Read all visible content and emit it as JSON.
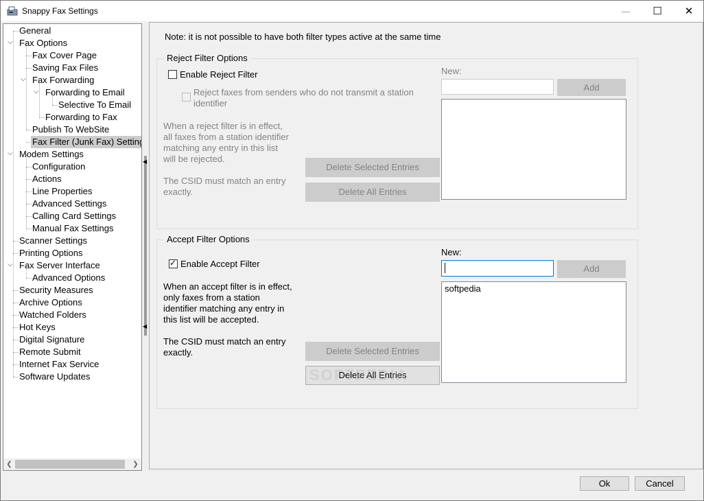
{
  "window": {
    "title": "Snappy Fax Settings",
    "minimize_glyph": "—",
    "maximize_glyph": "☐",
    "close_glyph": "✕"
  },
  "tree": {
    "items": [
      {
        "label": "General"
      },
      {
        "label": "Fax Options"
      },
      {
        "label": "Fax Cover Page"
      },
      {
        "label": "Saving Fax Files"
      },
      {
        "label": "Fax Forwarding"
      },
      {
        "label": "Forwarding to Email"
      },
      {
        "label": "Selective To Email"
      },
      {
        "label": "Forwarding to Fax"
      },
      {
        "label": "Publish To WebSite"
      },
      {
        "label": "Fax Filter (Junk Fax) Settings"
      },
      {
        "label": "Modem Settings"
      },
      {
        "label": "Configuration"
      },
      {
        "label": "Actions"
      },
      {
        "label": "Line Properties"
      },
      {
        "label": "Advanced Settings"
      },
      {
        "label": "Calling Card Settings"
      },
      {
        "label": "Manual Fax Settings"
      },
      {
        "label": "Scanner Settings"
      },
      {
        "label": "Printing Options"
      },
      {
        "label": "Fax Server Interface"
      },
      {
        "label": "Advanced Options"
      },
      {
        "label": "Security Measures"
      },
      {
        "label": "Archive Options"
      },
      {
        "label": "Watched Folders"
      },
      {
        "label": "Hot Keys"
      },
      {
        "label": "Digital Signature"
      },
      {
        "label": "Remote Submit"
      },
      {
        "label": "Internet Fax Service"
      },
      {
        "label": "Software Updates"
      }
    ],
    "selected": "Fax Filter (Junk Fax) Settings"
  },
  "note": "Note: it is not possible to have both filter types active at the same time",
  "reject": {
    "title": "Reject Filter Options",
    "enable_label": "Enable Reject Filter",
    "enable_checked": false,
    "no_id_label_line1": "Reject faxes from senders who do not transmit a station",
    "no_id_label_line2": "identifier",
    "desc_lines": [
      "When a reject filter is in effect,",
      "all faxes from a station identifier",
      "matching any entry in this list",
      "will be rejected."
    ],
    "csid_lines": [
      "The CSID must match an entry",
      "exactly."
    ],
    "new_label": "New:",
    "new_value": "",
    "add_label": "Add",
    "delete_selected_label": "Delete Selected Entries",
    "delete_all_label": "Delete All Entries",
    "entries": []
  },
  "accept": {
    "title": "Accept Filter Options",
    "enable_label": "Enable Accept Filter",
    "enable_checked": true,
    "desc_lines": [
      "When an accept filter is in effect,",
      "only faxes from a station",
      "identifier matching any entry in",
      "this list will be accepted."
    ],
    "csid_lines": [
      "The CSID must match an entry",
      "exactly."
    ],
    "new_label": "New:",
    "new_value": "",
    "add_label": "Add",
    "delete_selected_label": "Delete Selected Entries",
    "delete_all_label": "Delete All Entries",
    "entries": [
      "softpedia"
    ]
  },
  "watermark": "SOFTPEDIA",
  "footer": {
    "ok_label": "Ok",
    "cancel_label": "Cancel"
  },
  "colors": {
    "selection": "#cccccc",
    "focus_border": "#0078d7",
    "disabled_text": "#838383"
  }
}
